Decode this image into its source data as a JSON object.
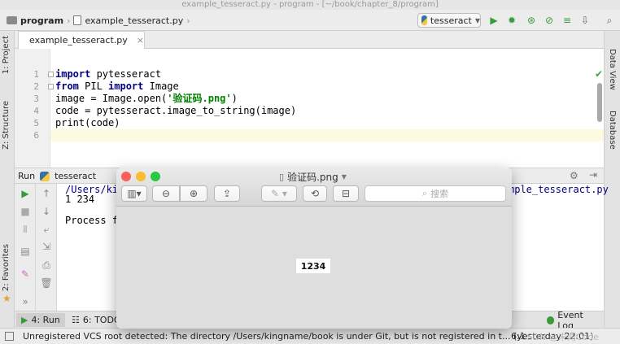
{
  "window": {
    "title": "example_tesseract.py - program - [~/book/chapter_8/program]"
  },
  "nav": {
    "crumb_project": "program",
    "crumb_file": "example_tesseract.py",
    "run_config": "tesseract"
  },
  "left_strip": {
    "project": "1: Project",
    "structure": "Z: Structure",
    "favorites": "2: Favorites"
  },
  "right_strip": {
    "data_view": "Data View",
    "database": "Database"
  },
  "editor": {
    "tab_label": "example_tesseract.py",
    "line_numbers": [
      "1",
      "2",
      "3",
      "4",
      "5",
      "6"
    ],
    "lines": {
      "l1_kw": "import",
      "l1_rest": " pytesseract",
      "l2_kw1": "from",
      "l2_mid": " PIL ",
      "l2_kw2": "import",
      "l2_rest": " Image",
      "l3_a": "image = Image.open(",
      "l3_str": "'验证码.png'",
      "l3_b": ")",
      "l4": "code = pytesseract.image_to_string(image)",
      "l5": "print(code)"
    }
  },
  "run_panel": {
    "label": "Run",
    "config": "tesseract",
    "console_line1_left": "/Users/kin",
    "console_line1_right": "mple_tesseract.py",
    "console_line2": "1 234",
    "console_line3": "Process fi"
  },
  "bottom_tabs": {
    "run": "4: Run",
    "todo": "6: TODO",
    "event_log": "Event Log"
  },
  "status": {
    "message": "Unregistered VCS root detected: The directory /Users/kingname/book is under Git, but is not registered in t... (yesterday 22:01)",
    "position": "6:1",
    "watermark": "CSDN @未闻Code"
  },
  "preview": {
    "title": "验证码.png",
    "search_placeholder": "搜索",
    "image_text": "1234"
  }
}
